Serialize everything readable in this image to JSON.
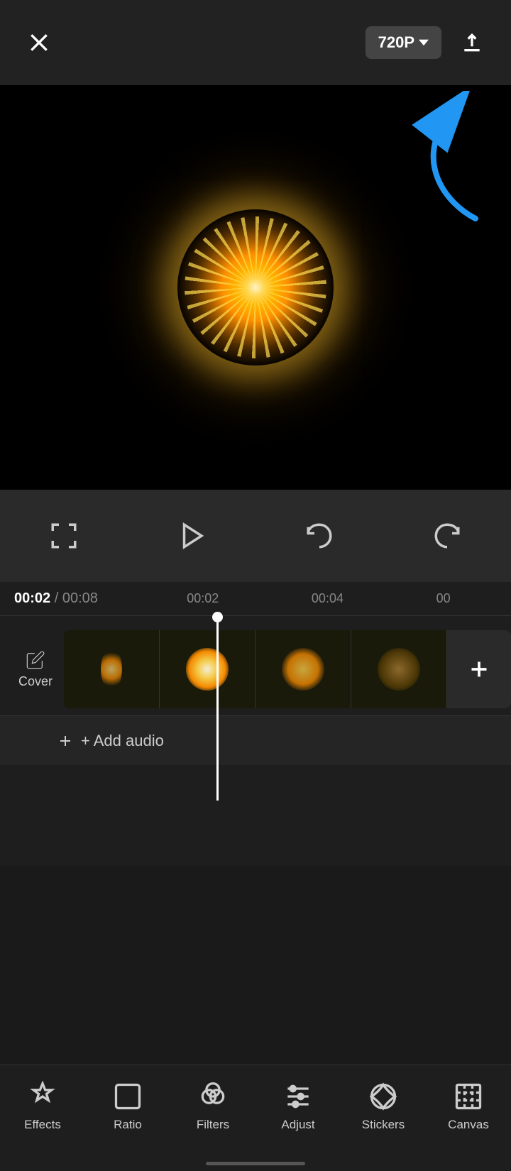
{
  "topbar": {
    "close_label": "×",
    "quality_label": "720P",
    "quality_dropdown_char": "▾"
  },
  "timeline": {
    "current_time": "00:02",
    "total_time": "00:08",
    "mark1": "00:02",
    "mark2": "00:04",
    "mark3": "00"
  },
  "cover_track": {
    "label": "Cover",
    "icon": "edit-icon"
  },
  "add_audio": {
    "label": "+ Add audio"
  },
  "controls": {
    "fullscreen_icon": "fullscreen-icon",
    "play_icon": "play-icon",
    "undo_icon": "undo-icon",
    "redo_icon": "redo-icon"
  },
  "bottom_toolbar": {
    "items": [
      {
        "id": "effects",
        "label": "Effects"
      },
      {
        "id": "ratio",
        "label": "Ratio"
      },
      {
        "id": "filters",
        "label": "Filters"
      },
      {
        "id": "adjust",
        "label": "Adjust"
      },
      {
        "id": "stickers",
        "label": "Stickers"
      },
      {
        "id": "canvas",
        "label": "Canvas"
      }
    ]
  }
}
